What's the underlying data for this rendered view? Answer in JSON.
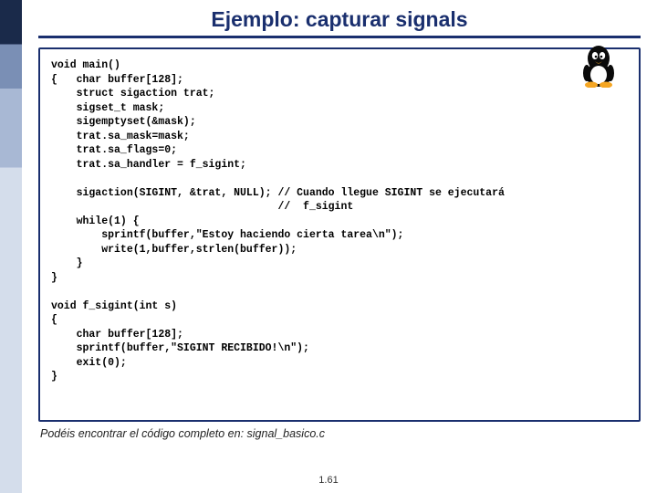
{
  "title": "Ejemplo: capturar signals",
  "code": "void main()\n{   char buffer[128];\n    struct sigaction trat;\n    sigset_t mask;\n    sigemptyset(&mask);\n    trat.sa_mask=mask;\n    trat.sa_flags=0;\n    trat.sa_handler = f_sigint;\n\n    sigaction(SIGINT, &trat, NULL); // Cuando llegue SIGINT se ejecutará\n                                    //  f_sigint\n    while(1) {\n        sprintf(buffer,\"Estoy haciendo cierta tarea\\n\");\n        write(1,buffer,strlen(buffer));\n    }\n}\n\nvoid f_sigint(int s)\n{\n    char buffer[128];\n    sprintf(buffer,\"SIGINT RECIBIDO!\\n\");\n    exit(0);\n}",
  "footnote": "Podéis encontrar el código completo en: signal_basico.c",
  "page_number": "1.61",
  "mascot_name": "tux-penguin"
}
